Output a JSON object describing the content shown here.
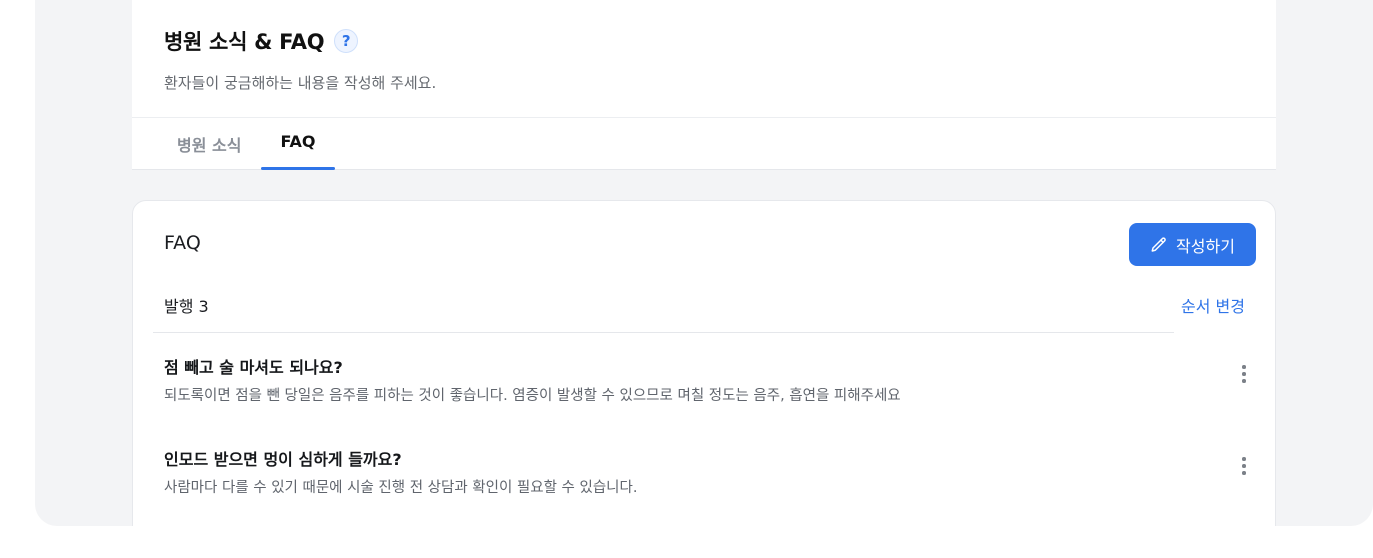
{
  "page": {
    "title": "병원 소식 & FAQ",
    "help_symbol": "?",
    "subtitle": "환자들이 궁금해하는 내용을 작성해 주세요."
  },
  "tabs": [
    {
      "label": "병원 소식",
      "active": false
    },
    {
      "label": "FAQ",
      "active": true
    }
  ],
  "faq_section": {
    "heading": "FAQ",
    "write_button": "작성하기",
    "published_label": "발행 3",
    "reorder_link": "순서 변경",
    "items": [
      {
        "question": "점 빼고 술 마셔도 되나요?",
        "answer": "되도록이면 점을 뺀 당일은 음주를 피하는 것이 좋습니다. 염증이 발생할 수 있으므로 며칠 정도는 음주, 흡연을 피해주세요"
      },
      {
        "question": "인모드 받으면 멍이 심하게 들까요?",
        "answer": "사람마다 다를 수 있기 때문에 시술 진행 전 상담과 확인이 필요할 수 있습니다."
      }
    ]
  },
  "colors": {
    "accent": "#2f74e8",
    "background": "#f3f4f6"
  },
  "icons": {
    "help": "question-circle-icon",
    "write": "pencil-icon",
    "more": "kebab-menu-icon"
  }
}
